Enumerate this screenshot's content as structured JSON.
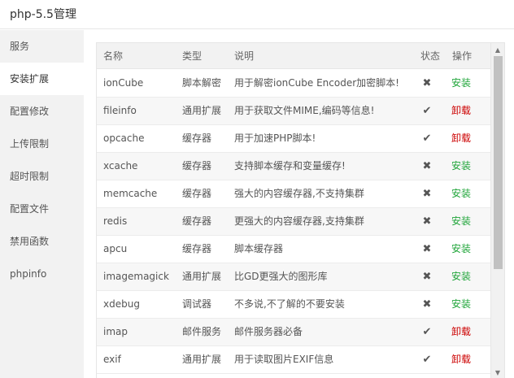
{
  "window": {
    "title": "php-5.5管理"
  },
  "sidebar": {
    "items": [
      {
        "label": "服务"
      },
      {
        "label": "安装扩展",
        "active": true
      },
      {
        "label": "配置修改"
      },
      {
        "label": "上传限制"
      },
      {
        "label": "超时限制"
      },
      {
        "label": "配置文件"
      },
      {
        "label": "禁用函数"
      },
      {
        "label": "phpinfo"
      }
    ]
  },
  "table": {
    "headers": {
      "name": "名称",
      "type": "类型",
      "desc": "说明",
      "status": "状态",
      "op": "操作"
    },
    "rows": [
      {
        "name": "ionCube",
        "type": "脚本解密",
        "desc": "用于解密ionCube Encoder加密脚本!",
        "status": "✖",
        "op": "安装"
      },
      {
        "name": "fileinfo",
        "type": "通用扩展",
        "desc": "用于获取文件MIME,编码等信息!",
        "status": "✔",
        "op": "卸载"
      },
      {
        "name": "opcache",
        "type": "缓存器",
        "desc": "用于加速PHP脚本!",
        "status": "✔",
        "op": "卸载"
      },
      {
        "name": "xcache",
        "type": "缓存器",
        "desc": "支持脚本缓存和变量缓存!",
        "status": "✖",
        "op": "安装"
      },
      {
        "name": "memcache",
        "type": "缓存器",
        "desc": "强大的内容缓存器,不支持集群",
        "status": "✖",
        "op": "安装"
      },
      {
        "name": "redis",
        "type": "缓存器",
        "desc": "更强大的内容缓存器,支持集群",
        "status": "✖",
        "op": "安装"
      },
      {
        "name": "apcu",
        "type": "缓存器",
        "desc": "脚本缓存器",
        "status": "✖",
        "op": "安装"
      },
      {
        "name": "imagemagick",
        "type": "通用扩展",
        "desc": "比GD更强大的图形库",
        "status": "✖",
        "op": "安装"
      },
      {
        "name": "xdebug",
        "type": "调试器",
        "desc": "不多说,不了解的不要安装",
        "status": "✖",
        "op": "安装"
      },
      {
        "name": "imap",
        "type": "邮件服务",
        "desc": "邮件服务器必备",
        "status": "✔",
        "op": "卸载"
      },
      {
        "name": "exif",
        "type": "通用扩展",
        "desc": "用于读取图片EXIF信息",
        "status": "✔",
        "op": "卸载"
      }
    ]
  },
  "colors": {
    "install": "#20a53a",
    "uninstall": "#cc0000"
  },
  "icons": {
    "installed": "check-icon",
    "not_installed": "cross-icon"
  }
}
